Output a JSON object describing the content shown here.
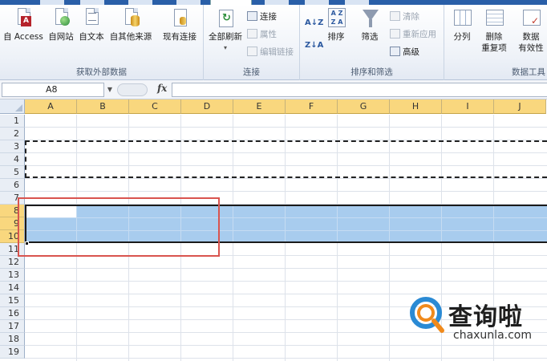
{
  "ribbon": {
    "groups": {
      "external_data": {
        "label": "获取外部数据",
        "buttons": {
          "access": "自 Access",
          "web": "自网站",
          "text": "自文本",
          "other": "自其他来源",
          "existing": "现有连接"
        }
      },
      "connections": {
        "label": "连接",
        "refresh_all": "全部刷新",
        "connections": "连接",
        "properties": "属性",
        "edit_links": "编辑链接"
      },
      "sort_filter": {
        "label": "排序和筛选",
        "sort_az": "A↓Z",
        "sort_za": "Z↓A",
        "sort": "排序",
        "filter": "筛选",
        "clear": "清除",
        "reapply": "重新应用",
        "advanced": "高级"
      },
      "data_tools": {
        "label": "数据工具",
        "text_to_columns": "分列",
        "remove_duplicates_1": "删除",
        "remove_duplicates_2": "重复项",
        "data_validation_1": "数据",
        "data_validation_2": "有效性"
      }
    }
  },
  "formula_bar": {
    "name_box": "A8",
    "fx": "fx",
    "value": ""
  },
  "sheet": {
    "columns": [
      "A",
      "B",
      "C",
      "D",
      "E",
      "F",
      "G",
      "H",
      "I",
      "J"
    ],
    "rows": [
      "1",
      "2",
      "3",
      "4",
      "5",
      "6",
      "7",
      "8",
      "9",
      "10",
      "11",
      "12",
      "13",
      "14",
      "15",
      "16",
      "17",
      "18",
      "19"
    ],
    "selected_rows": [
      "8",
      "9",
      "10"
    ],
    "active_cell": "A8"
  },
  "watermark": {
    "title": "查询啦",
    "url": "chaxunla.com"
  },
  "colors": {
    "selection": "#a8ccee",
    "header_highlight": "#f9d77e",
    "annotation": "#d9544f"
  }
}
